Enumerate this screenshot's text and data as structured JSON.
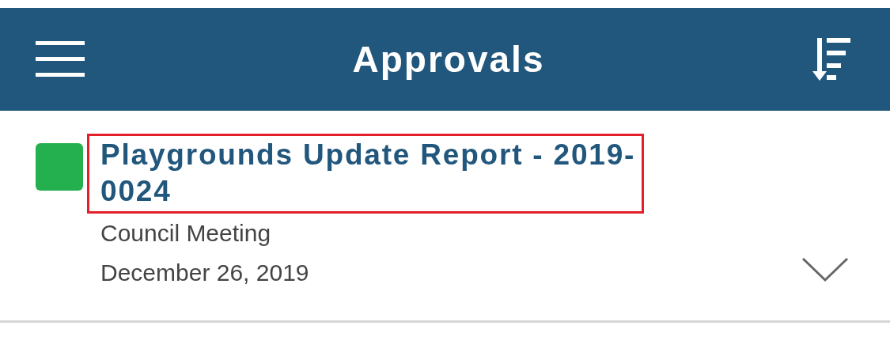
{
  "header": {
    "title": "Approvals"
  },
  "items": [
    {
      "title_lines": [
        "Playgrounds Update Report - 2019-",
        "0024"
      ],
      "color": "#24b04f",
      "highlighted": true,
      "meeting": "Council Meeting",
      "date": "December 26, 2019",
      "expanded": false
    }
  ]
}
